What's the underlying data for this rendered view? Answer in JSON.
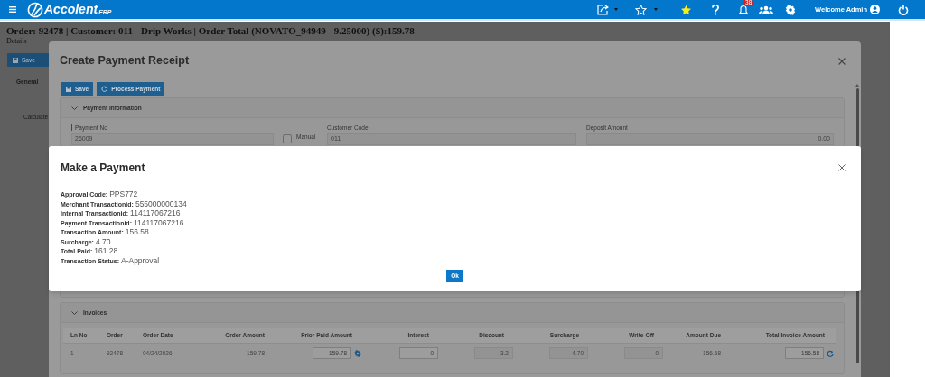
{
  "topbar": {
    "app_name": "Accolent",
    "app_suffix": "ERP",
    "notification_count": "38",
    "welcome": "Welcome Admin"
  },
  "page": {
    "title": "Order: 92478 | Customer: 011 - Drip Works | Order Total (NOVATO_94949 - 9.25000) ($):159.78",
    "subtitle": "Details",
    "save_button": "Save",
    "tabs": [
      {
        "label": "General",
        "selected": true
      }
    ],
    "side_label": "Calculate"
  },
  "receipt_dialog": {
    "title": "Create Payment Receipt",
    "buttons": [
      {
        "label": "Save",
        "kind": "save"
      },
      {
        "label": "Process Payment",
        "kind": "process"
      }
    ],
    "payment_panel": {
      "title": "Payment Information",
      "fields": [
        {
          "label": "Payment No",
          "value": "26009",
          "required": true
        },
        {
          "label": "Customer Code",
          "value": "011",
          "required": false
        },
        {
          "label": "Deposit Amount",
          "value": "0.00",
          "required": false
        }
      ],
      "manual_entry": {
        "label": "Manual",
        "checked": false
      }
    },
    "invoices_panel": {
      "title": "Invoices",
      "columns": [
        "Ln No",
        "Order",
        "Order Date",
        "Order Amount",
        "Prior Paid Amount",
        "Interest",
        "Discount",
        "Surcharge",
        "Write-Off",
        "Amount Due",
        "Total Invoice Amount"
      ],
      "rows": [
        [
          {
            "value": "1",
            "kind": "text"
          },
          {
            "value": "92478",
            "kind": "text"
          },
          {
            "value": "04/24/2026",
            "kind": "text"
          },
          {
            "value": "159.78",
            "kind": "amount"
          },
          {
            "value": "159.78",
            "kind": "input_settings"
          },
          {
            "value": "0",
            "kind": "input"
          },
          {
            "value": "3.2",
            "kind": "disabled"
          },
          {
            "value": "4.70",
            "kind": "disabled"
          },
          {
            "value": "0",
            "kind": "disabled"
          },
          {
            "value": "156.58",
            "kind": "amount"
          },
          {
            "value": "156.58",
            "kind": "input_refresh"
          }
        ]
      ]
    }
  },
  "payment_dialog": {
    "title": "Make a Payment",
    "lines": [
      {
        "label": "Approval Code:",
        "value": "PPS772"
      },
      {
        "label": "Merchant Transactionid:",
        "value": "555000000134"
      },
      {
        "label": "Internal Transactionid:",
        "value": "114117067216"
      },
      {
        "label": "Payment Transactionid:",
        "value": "114117067216"
      },
      {
        "label": "Transaction Amount:",
        "value": "156.58"
      },
      {
        "label": "Surcharge:",
        "value": "4.70"
      },
      {
        "label": "Total Paid:",
        "value": "161.28"
      },
      {
        "label": "Transaction Status:",
        "value": "A-Approval"
      }
    ],
    "ok_button": "Ok"
  }
}
